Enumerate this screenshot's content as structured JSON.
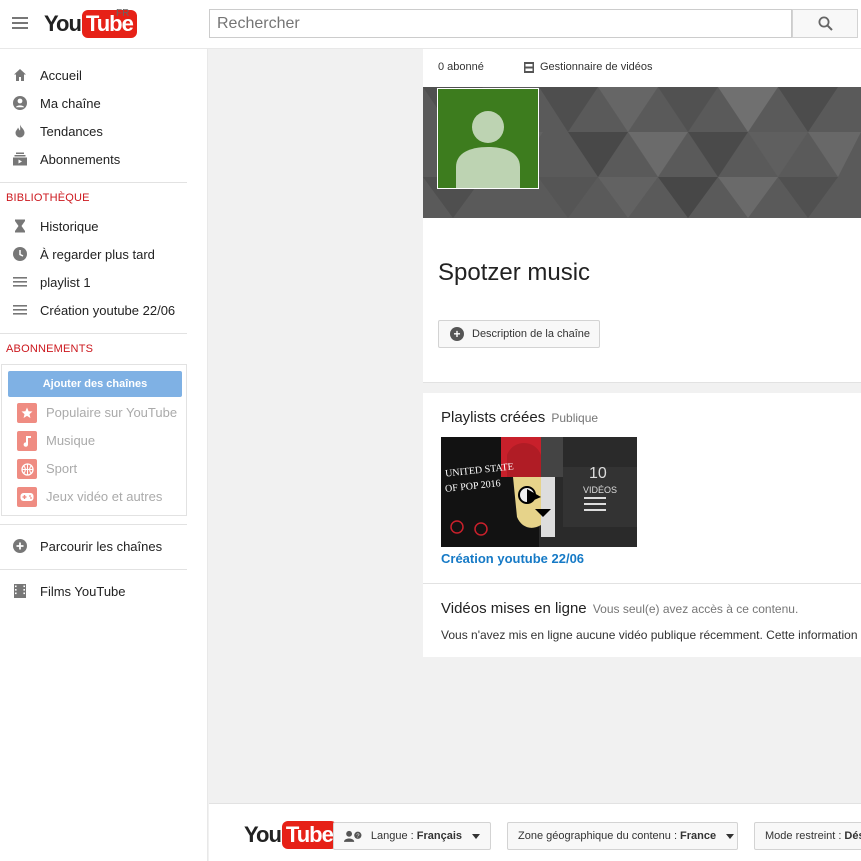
{
  "header": {
    "logo_you": "You",
    "logo_tube": "Tube",
    "country": "FR",
    "search_placeholder": "Rechercher"
  },
  "sidebar": {
    "main_items": [
      {
        "label": "Accueil",
        "icon": "home-icon"
      },
      {
        "label": "Ma chaîne",
        "icon": "account-icon"
      },
      {
        "label": "Tendances",
        "icon": "flame-icon"
      },
      {
        "label": "Abonnements",
        "icon": "subscriptions-icon"
      }
    ],
    "library_heading": "BIBLIOTHÈQUE",
    "library_items": [
      {
        "label": "Historique",
        "icon": "hourglass-icon"
      },
      {
        "label": "À regarder plus tard",
        "icon": "clock-icon"
      },
      {
        "label": "playlist 1",
        "icon": "playlist-icon"
      },
      {
        "label": "Création youtube 22/06",
        "icon": "playlist-icon"
      }
    ],
    "subscriptions_heading": "ABONNEMENTS",
    "add_channels_label": "Ajouter des chaînes",
    "suggested_items": [
      {
        "label": "Populaire sur YouTube",
        "icon": "star-icon"
      },
      {
        "label": "Musique",
        "icon": "music-note-icon"
      },
      {
        "label": "Sport",
        "icon": "ball-icon"
      },
      {
        "label": "Jeux vidéo et autres",
        "icon": "gamepad-icon"
      }
    ],
    "browse_channels_label": "Parcourir les chaînes",
    "movies_label": "Films YouTube"
  },
  "channel": {
    "subscriber_count": "0 abonné",
    "video_manager_label": "Gestionnaire de vidéos",
    "name": "Spotzer music",
    "description_button": "Description de la chaîne",
    "avatar_color": "#3d7c1e"
  },
  "playlists_section": {
    "title": "Playlists créées",
    "visibility": "Publique",
    "playlist_title": "Création youtube 22/06",
    "thumbnail_text_1": "UNITED STATE",
    "thumbnail_text_2": "OF POP 2016",
    "thumbnail_count": "10",
    "thumbnail_count_label": "VIDÉOS"
  },
  "uploads_section": {
    "title": "Vidéos mises en ligne",
    "note": "Vous seul(e) avez accès à ce contenu.",
    "empty_message": "Vous n'avez mis en ligne aucune vidéo publique récemment. Cette information n"
  },
  "footer": {
    "logo_you": "You",
    "logo_tube": "Tube",
    "language_label": "Langue :",
    "language_value": "Français",
    "region_label": "Zone géographique du contenu :",
    "region_value": "France",
    "restricted_label": "Mode restreint :",
    "restricted_value": "Dés"
  },
  "colors": {
    "brand_red": "#e62117",
    "link_blue": "#167ac6",
    "section_red": "#cc181e",
    "add_channels_blue": "#7fb1e4"
  }
}
